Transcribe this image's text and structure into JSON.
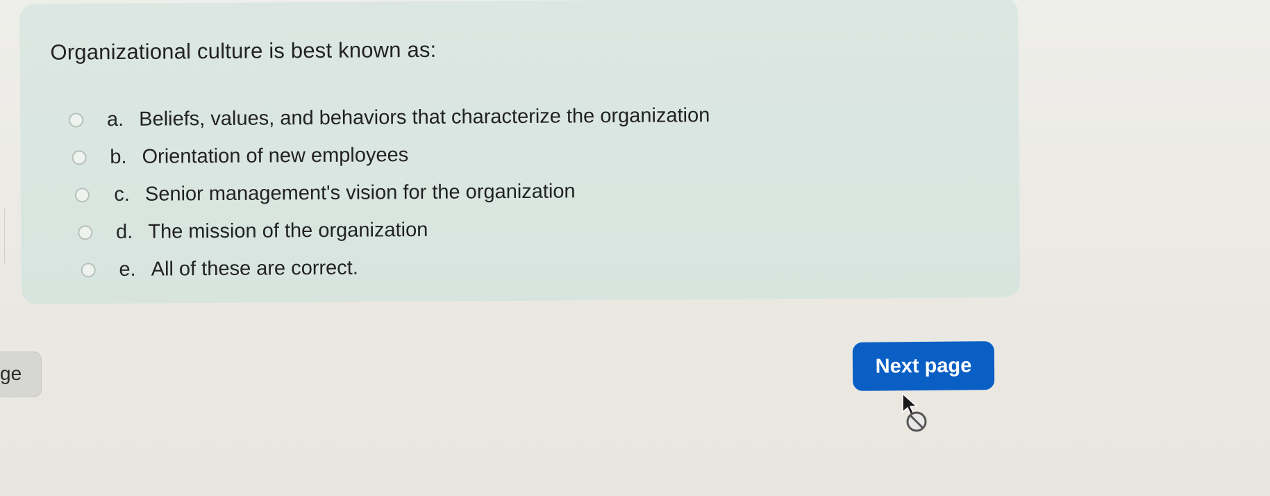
{
  "question": {
    "text": "Organizational culture is best known as:",
    "answers": [
      {
        "letter": "a.",
        "label": "Beliefs, values, and behaviors that characterize the organization"
      },
      {
        "letter": "b.",
        "label": "Orientation of new employees"
      },
      {
        "letter": "c.",
        "label": "Senior management's vision for the organization"
      },
      {
        "letter": "d.",
        "label": "The mission of the organization"
      },
      {
        "letter": "e.",
        "label": "All of these are correct."
      }
    ]
  },
  "navigation": {
    "previous_label_fragment": "ge",
    "next_label": "Next page"
  },
  "colors": {
    "card_background": "#d9e6e1",
    "primary_button": "#0a5fc4",
    "page_background": "#eceae5"
  },
  "icons": {
    "cursor": "not-allowed-cursor-icon"
  }
}
